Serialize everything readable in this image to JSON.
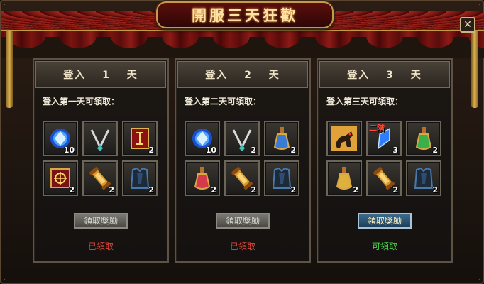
{
  "window": {
    "title": "開服三天狂歡",
    "close_label": "✕"
  },
  "panels": [
    {
      "title": "登入　 1　 天",
      "subtitle": "登入第一天可領取：",
      "button": "領取獎勵",
      "status": "已領取",
      "button_enabled": false,
      "items": [
        {
          "icon": "blue-gem-icon",
          "count": "10",
          "rank": ""
        },
        {
          "icon": "silver-necklace-icon",
          "count": "",
          "rank": ""
        },
        {
          "icon": "red-banner-scroll-icon",
          "count": "2",
          "rank": ""
        },
        {
          "icon": "red-map-scroll-icon",
          "count": "2",
          "rank": ""
        },
        {
          "icon": "golden-scroll-icon",
          "count": "2",
          "rank": ""
        },
        {
          "icon": "dark-armor-icon",
          "count": "2",
          "rank": ""
        }
      ]
    },
    {
      "title": "登入　 2　 天",
      "subtitle": "登入第二天可領取：",
      "button": "領取獎勵",
      "status": "已領取",
      "button_enabled": false,
      "items": [
        {
          "icon": "blue-gem-icon",
          "count": "10",
          "rank": ""
        },
        {
          "icon": "silver-necklace-icon",
          "count": "2",
          "rank": ""
        },
        {
          "icon": "blue-potion-icon",
          "count": "2",
          "rank": ""
        },
        {
          "icon": "red-potion-icon",
          "count": "2",
          "rank": ""
        },
        {
          "icon": "golden-scroll-icon",
          "count": "2",
          "rank": ""
        },
        {
          "icon": "dark-armor-icon",
          "count": "2",
          "rank": ""
        }
      ]
    },
    {
      "title": "登入　 3　 天",
      "subtitle": "登入第三天可領取：",
      "button": "領取獎勵",
      "status": "可領取",
      "button_enabled": true,
      "items": [
        {
          "icon": "beast-mount-icon",
          "count": "",
          "rank": ""
        },
        {
          "icon": "blue-crystal-icon",
          "count": "3",
          "rank": "二階"
        },
        {
          "icon": "green-potion-icon",
          "count": "2",
          "rank": ""
        },
        {
          "icon": "yellow-potion-icon",
          "count": "2",
          "rank": ""
        },
        {
          "icon": "golden-scroll-icon",
          "count": "2",
          "rank": ""
        },
        {
          "icon": "dark-armor-icon",
          "count": "2",
          "rank": ""
        }
      ]
    }
  ],
  "colors": {
    "claimed": "#e4483a",
    "available": "#49d84a",
    "title": "#ffe3a6"
  }
}
